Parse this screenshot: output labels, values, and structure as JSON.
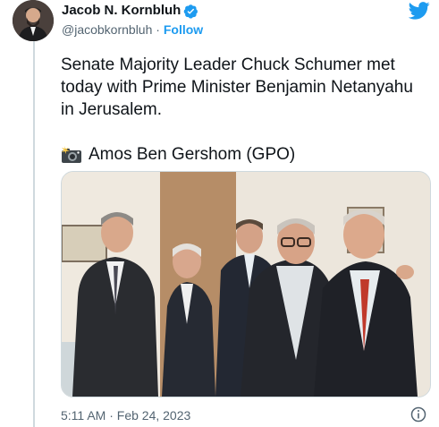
{
  "tweet": {
    "author": {
      "display_name": "Jacob N. Kornbluh",
      "handle": "@jacobkornbluh",
      "separator": "·",
      "follow_label": "Follow",
      "verified": true
    },
    "text": "Senate Majority Leader Chuck Schumer met today with Prime Minister Benjamin Netanyahu in Jerusalem.",
    "photo_credit": "Amos Ben Gershom (GPO)",
    "timestamp": "5:11 AM · Feb 24, 2023"
  },
  "icons": {
    "brand": "twitter-bird-icon",
    "verified": "verified-badge-icon",
    "camera": "camera-flash-icon",
    "info": "info-icon"
  },
  "colors": {
    "twitter_blue": "#1d9bf0",
    "text_primary": "#0f1419",
    "text_secondary": "#536471",
    "border": "#cfd9de"
  }
}
